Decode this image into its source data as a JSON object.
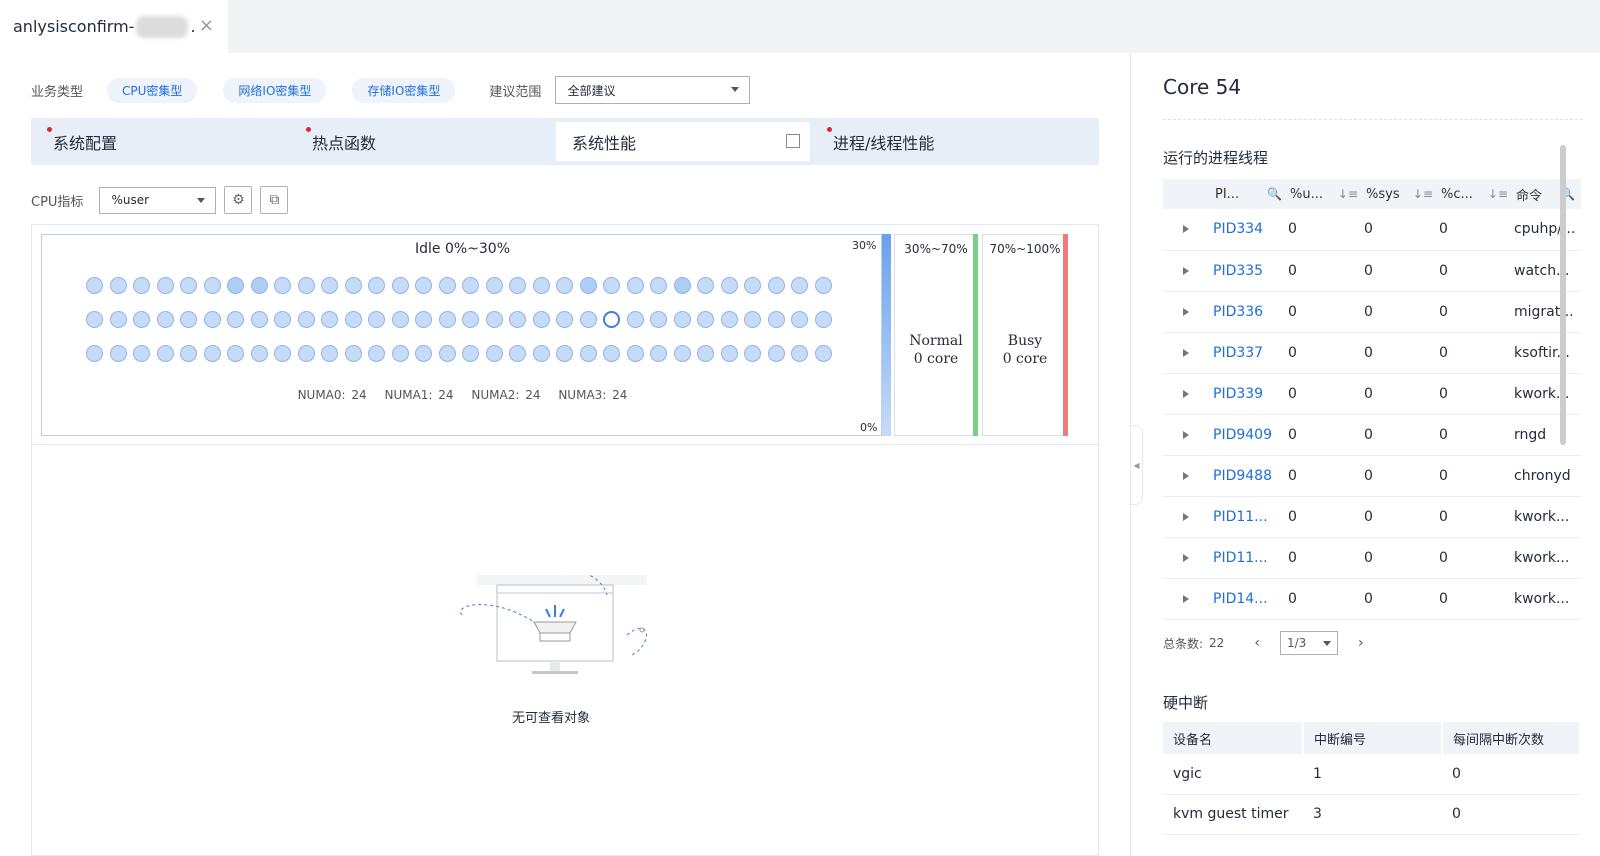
{
  "tab": {
    "title_prefix": "anlysisconfirm-",
    "title_suffix": ".",
    "close": "×"
  },
  "filters": {
    "business_label": "业务类型",
    "chips": [
      "CPU密集型",
      "网络IO密集型",
      "存储IO密集型"
    ],
    "scope_label": "建议范围",
    "scope_value": "全部建议"
  },
  "section_tabs": [
    "系统配置",
    "热点函数",
    "系统性能",
    "进程/线程性能"
  ],
  "cpu_metric": {
    "label": "CPU指标",
    "value": "%user"
  },
  "heatmap": {
    "title": "Idle 0%~30%",
    "scale_top": "30%",
    "scale_bottom": "0%",
    "numa": [
      "NUMA0: 24",
      "NUMA1: 24",
      "NUMA2: 24",
      "NUMA3: 24"
    ],
    "normal": {
      "range": "30%~70%",
      "name": "Normal",
      "count": "0 core"
    },
    "busy": {
      "range": "70%~100%",
      "name": "Busy",
      "count": "0 core"
    }
  },
  "empty_text": "无可查看对象",
  "core": {
    "title": "Core 54",
    "proc_section": "运行的进程线程",
    "headers": [
      "PI...",
      "%u...",
      "%sys",
      "%c...",
      "命令"
    ],
    "rows": [
      [
        "PID334",
        "0",
        "0",
        "0",
        "cpuhp/..."
      ],
      [
        "PID335",
        "0",
        "0",
        "0",
        "watch..."
      ],
      [
        "PID336",
        "0",
        "0",
        "0",
        "migrat..."
      ],
      [
        "PID337",
        "0",
        "0",
        "0",
        "ksoftir..."
      ],
      [
        "PID339",
        "0",
        "0",
        "0",
        "kwork..."
      ],
      [
        "PID9409",
        "0",
        "0",
        "0",
        "rngd"
      ],
      [
        "PID9488",
        "0",
        "0",
        "0",
        "chronyd"
      ],
      [
        "PID11...",
        "0",
        "0",
        "0",
        "kwork..."
      ],
      [
        "PID11...",
        "0",
        "0",
        "0",
        "kwork..."
      ],
      [
        "PID14...",
        "0",
        "0",
        "0",
        "kwork..."
      ]
    ],
    "total_label": "总条数:",
    "total": "22",
    "page": "1/3",
    "irq_section": "硬中断",
    "irq_headers": [
      "设备名",
      "中断编号",
      "每间隔中断次数"
    ],
    "irq_rows": [
      [
        "vgic",
        "1",
        "0"
      ],
      [
        "kvm guest timer",
        "3",
        "0"
      ]
    ]
  }
}
